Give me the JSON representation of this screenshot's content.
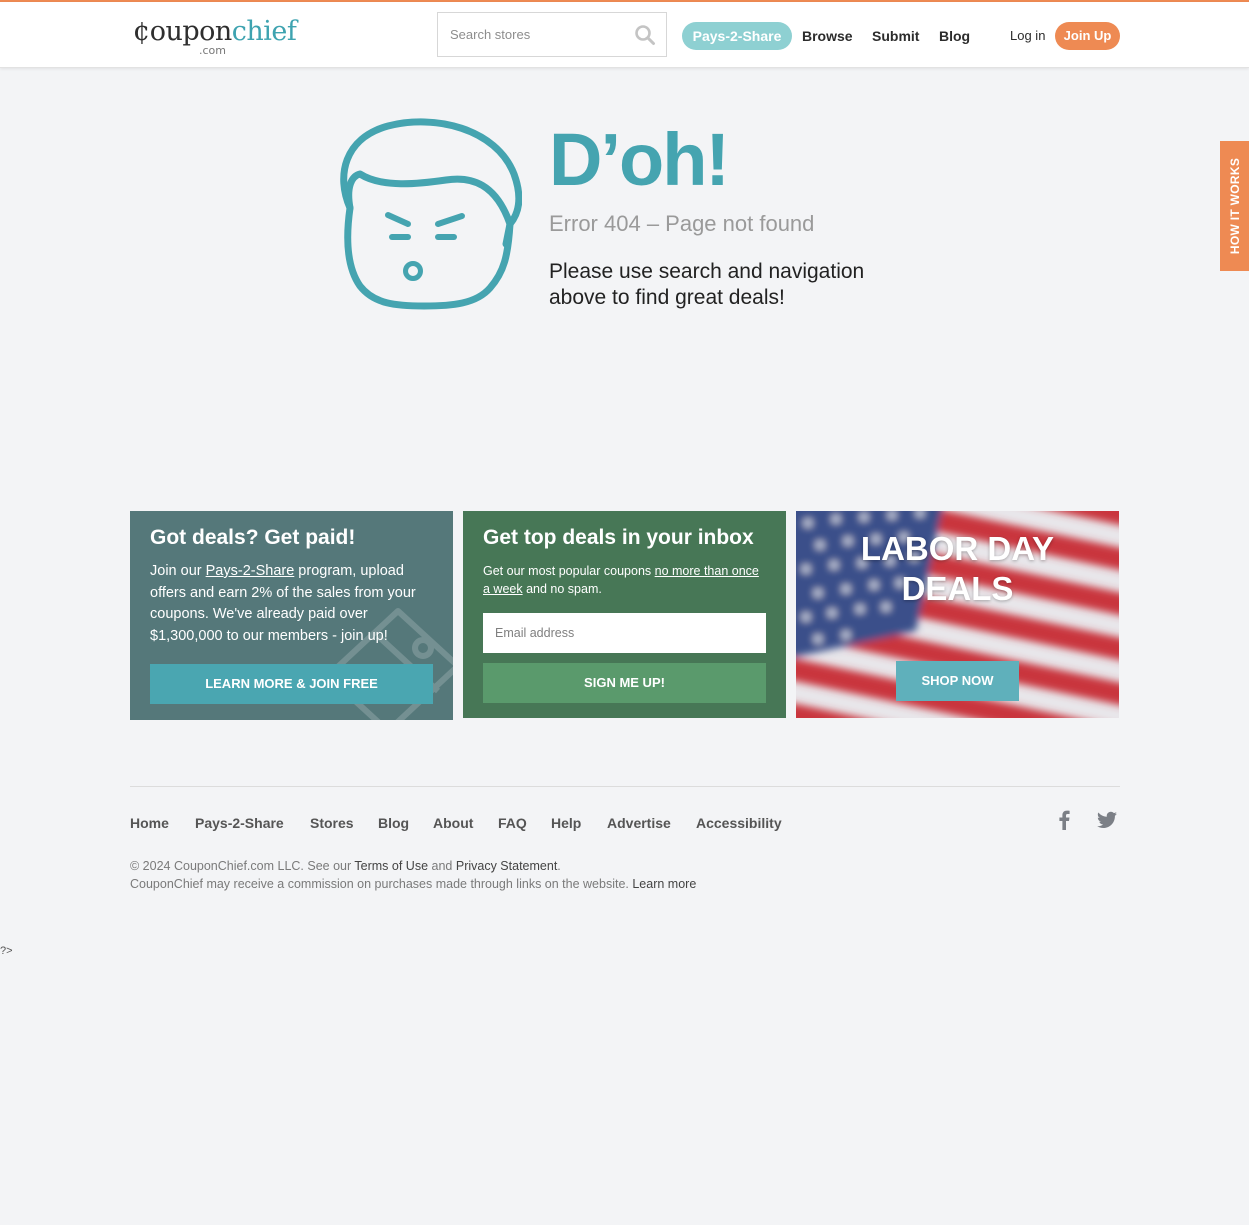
{
  "header": {
    "logo_cent": "¢",
    "logo_coupon": "oupon",
    "logo_chief": "chief",
    "logo_com": ".com",
    "search_placeholder": "Search stores",
    "nav": {
      "pays2share": "Pays-2-Share",
      "browse": "Browse",
      "submit": "Submit",
      "blog": "Blog",
      "login": "Log in",
      "joinup": "Join Up"
    },
    "how_it_works": "HOW IT WORKS"
  },
  "error": {
    "title": "D’oh!",
    "subtitle": "Error 404 – Page not found",
    "message_line1": "Please use search and navigation",
    "message_line2": "above to find great deals!"
  },
  "cards": {
    "paid": {
      "title": "Got deals? Get paid!",
      "text_before": "Join our ",
      "link": "Pays-2-Share",
      "text_after": " program, upload offers and earn 2% of the sales from your coupons. We've already paid over $1,300,000 to our members - join up!",
      "button": "LEARN MORE & JOIN FREE"
    },
    "inbox": {
      "title": "Get top deals in your inbox",
      "text_before": "Get our most popular coupons ",
      "link": "no more than once a week",
      "text_after": " and no spam.",
      "email_placeholder": "Email address",
      "button": "SIGN ME UP!"
    },
    "laborday": {
      "title_line1": "LABOR DAY",
      "title_line2": "DEALS",
      "button": "SHOP NOW"
    }
  },
  "footer": {
    "links": [
      "Home",
      "Pays-2-Share",
      "Stores",
      "Blog",
      "About",
      "FAQ",
      "Help",
      "Advertise",
      "Accessibility"
    ],
    "copy_prefix": "© 2024 CouponChief.com LLC. See our ",
    "terms": "Terms of Use",
    "and": " and ",
    "privacy": "Privacy Statement",
    "period": ".",
    "commission": "CouponChief may receive a commission on purchases made through links on the website. ",
    "learn_more": "Learn more"
  },
  "stray_text": "?>",
  "colors": {
    "accent_orange": "#ee8a53",
    "teal": "#45a4b0",
    "card_teal": "#55787a",
    "card_green": "#477756"
  }
}
